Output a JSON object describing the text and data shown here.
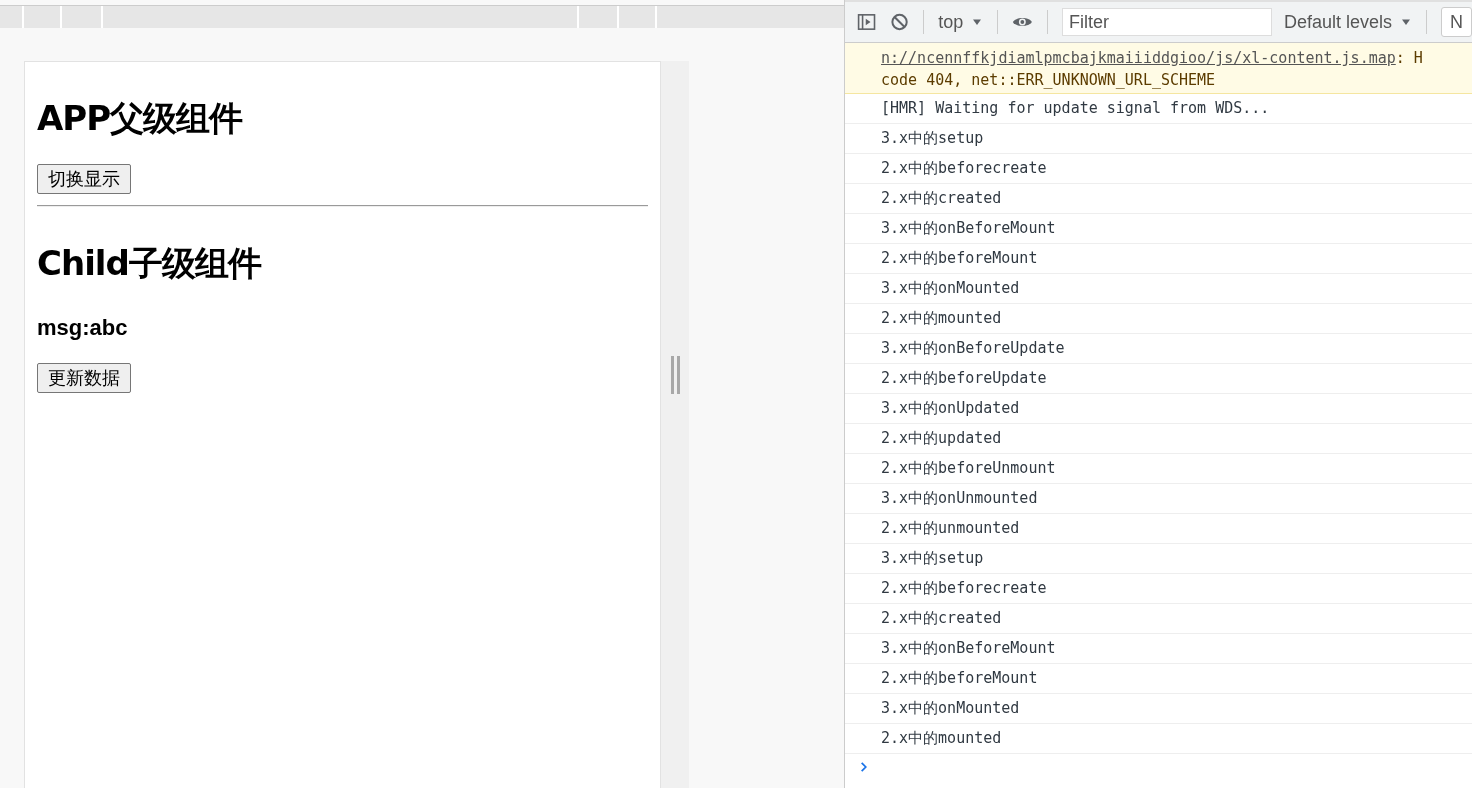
{
  "page": {
    "title": "APP父级组件",
    "toggle_button": "切换显示",
    "child_title": "Child子级组件",
    "msg": "msg:abc",
    "update_button": "更新数据"
  },
  "devtools": {
    "toolbar": {
      "context": "top",
      "filter": {
        "placeholder": "Filter"
      },
      "levels": "Default levels",
      "edge_button": "N"
    },
    "warning": {
      "link": "n://ncennffkjdiamlpmcbajkmaiiiddgioo/js/xl-content.js.map",
      "link_tail": ": H",
      "line2": "code 404, net::ERR_UNKNOWN_URL_SCHEME"
    },
    "messages": [
      "[HMR] Waiting for update signal from WDS...",
      "3.x中的setup",
      "2.x中的beforecreate",
      "2.x中的created",
      "3.x中的onBeforeMount",
      "2.x中的beforeMount",
      "3.x中的onMounted",
      "2.x中的mounted",
      "3.x中的onBeforeUpdate",
      "2.x中的beforeUpdate",
      "3.x中的onUpdated",
      "2.x中的updated",
      "2.x中的beforeUnmount",
      "3.x中的onUnmounted",
      "2.x中的unmounted",
      "3.x中的setup",
      "2.x中的beforecreate",
      "2.x中的created",
      "3.x中的onBeforeMount",
      "2.x中的beforeMount",
      "3.x中的onMounted",
      "2.x中的mounted"
    ]
  }
}
